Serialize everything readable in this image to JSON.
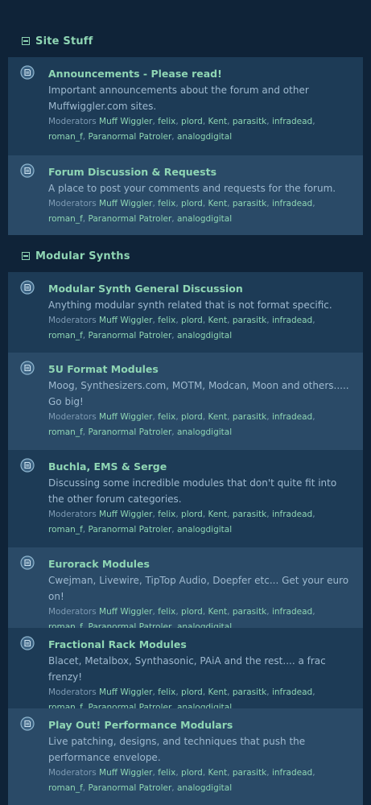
{
  "sections": [
    {
      "title": "Site Stuff",
      "forums": [
        {
          "title": "Announcements - Please read!",
          "description": "Important announcements about the forum and other Muffwiggler.com sites.",
          "moderators_label": "Moderators",
          "moderators": [
            "Muff Wiggler",
            "felix",
            "plord",
            "Kent",
            "parasitk",
            "infradead",
            "roman_f",
            "Paranormal Patroler",
            "analogdigital"
          ]
        },
        {
          "title": "Forum Discussion & Requests",
          "description": "A place to post your comments and requests for the forum.",
          "moderators_label": "Moderators",
          "moderators": [
            "Muff Wiggler",
            "felix",
            "plord",
            "Kent",
            "parasitk",
            "infradead",
            "roman_f",
            "Paranormal Patroler",
            "analogdigital"
          ]
        }
      ]
    },
    {
      "title": "Modular Synths",
      "forums": [
        {
          "title": "Modular Synth General Discussion",
          "description": "Anything modular synth related that is not format specific.",
          "moderators_label": "Moderators",
          "moderators": [
            "Muff Wiggler",
            "felix",
            "plord",
            "Kent",
            "parasitk",
            "infradead",
            "roman_f",
            "Paranormal Patroler",
            "analogdigital"
          ]
        },
        {
          "title": "5U Format Modules",
          "description": "Moog, Synthesizers.com, MOTM, Modcan, Moon and others..... Go big!",
          "moderators_label": "Moderators",
          "moderators": [
            "Muff Wiggler",
            "felix",
            "plord",
            "Kent",
            "parasitk",
            "infradead",
            "roman_f",
            "Paranormal Patroler",
            "analogdigital"
          ]
        },
        {
          "title": "Buchla, EMS & Serge",
          "description": "Discussing some incredible modules that don't quite fit into the other forum categories.",
          "moderators_label": "Moderators",
          "moderators": [
            "Muff Wiggler",
            "felix",
            "plord",
            "Kent",
            "parasitk",
            "infradead",
            "roman_f",
            "Paranormal Patroler",
            "analogdigital"
          ]
        },
        {
          "title": "Eurorack Modules",
          "description": "Cwejman, Livewire, TipTop Audio, Doepfer etc... Get your euro on!",
          "moderators_label": "Moderators",
          "moderators": [
            "Muff Wiggler",
            "felix",
            "plord",
            "Kent",
            "parasitk",
            "infradead",
            "roman_f",
            "Paranormal Patroler",
            "analogdigital"
          ]
        },
        {
          "title": "Fractional Rack Modules",
          "description": "Blacet, Metalbox, Synthasonic, PAiA and the rest.... a frac frenzy!",
          "moderators_label": "Moderators",
          "moderators": [
            "Muff Wiggler",
            "felix",
            "plord",
            "Kent",
            "parasitk",
            "infradead",
            "roman_f",
            "Paranormal Patroler",
            "analogdigital"
          ]
        },
        {
          "title": "Play Out! Performance Modulars",
          "description": "Live patching, designs, and techniques that push the performance envelope.",
          "moderators_label": "Moderators",
          "moderators": [
            "Muff Wiggler",
            "felix",
            "plord",
            "Kent",
            "parasitk",
            "infradead",
            "roman_f",
            "Paranormal Patroler",
            "analogdigital"
          ]
        }
      ]
    }
  ],
  "colors": {
    "background": "#0f2338",
    "row_odd": "#1d3b56",
    "row_even": "#2a4a67",
    "accent": "#8fd6b4",
    "text_muted": "#9fbad0"
  },
  "icons": {
    "forum_icon": "forum-bubble-icon",
    "section_toggle": "collapse-minus-icon"
  }
}
